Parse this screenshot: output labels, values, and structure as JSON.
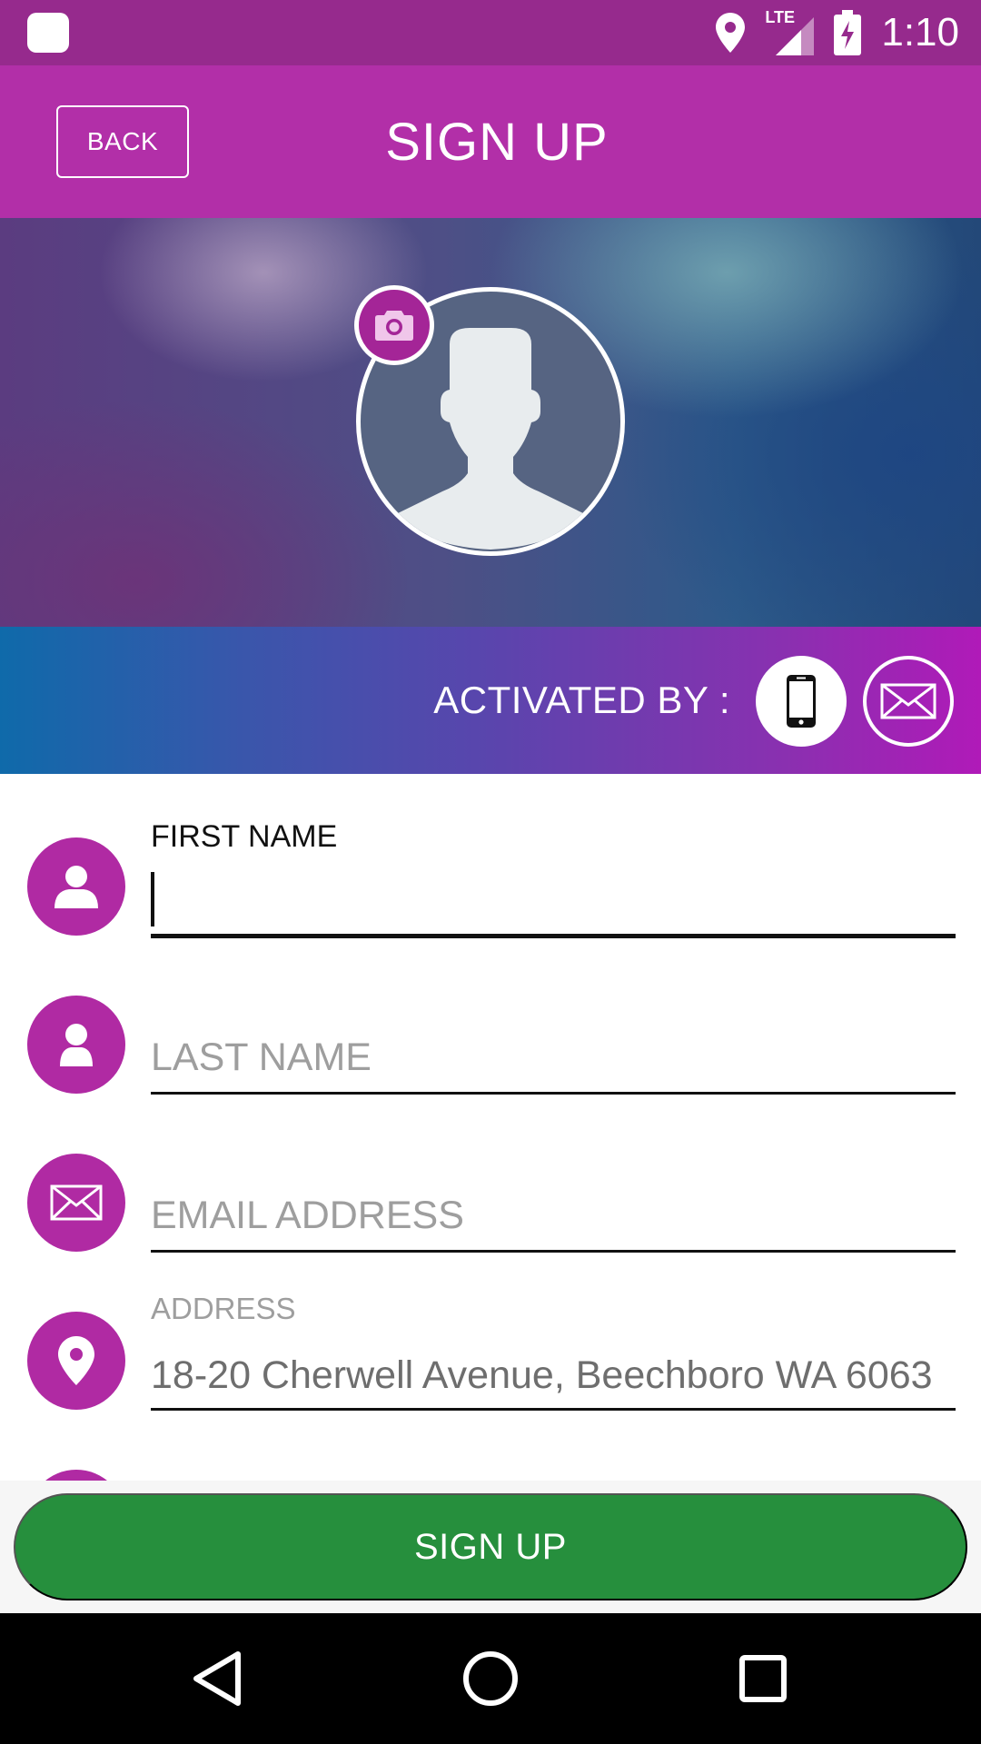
{
  "status_bar": {
    "time": "1:10",
    "network": "LTE",
    "icons": [
      "app-icon",
      "location-icon",
      "lte-signal-icon",
      "battery-charging-icon"
    ],
    "color": "#962a8d"
  },
  "header": {
    "back_label": "BACK",
    "title": "SIGN UP",
    "color": "#b22fa8"
  },
  "profile": {
    "avatar_icon": "avatar-silhouette-icon",
    "camera_icon": "camera-icon"
  },
  "activation": {
    "label": "ACTIVATED BY :",
    "options": [
      {
        "icon": "phone-icon",
        "selected": true
      },
      {
        "icon": "email-icon",
        "selected": false
      }
    ]
  },
  "form": {
    "accent_color": "#b02aa3",
    "first_name": {
      "label": "FIRST NAME",
      "value": "",
      "icon": "person-icon"
    },
    "last_name": {
      "placeholder": "LAST NAME",
      "icon": "person-icon"
    },
    "email": {
      "placeholder": "EMAIL ADDRESS",
      "icon": "envelope-icon"
    },
    "address": {
      "label": "ADDRESS",
      "value": "18-20 Cherwell Avenue, Beechboro WA 6063",
      "icon": "location-pin-icon"
    }
  },
  "footer": {
    "signup_label": "SIGN UP",
    "button_color": "#268f3d"
  },
  "nav": {
    "icons": [
      "back-triangle-icon",
      "home-circle-icon",
      "recents-square-icon"
    ]
  }
}
